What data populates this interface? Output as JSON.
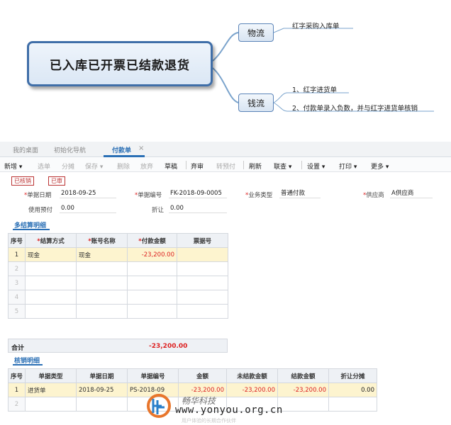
{
  "mindmap": {
    "root": "已入库已开票已结款退货",
    "branches": [
      {
        "label": "物流",
        "items": [
          "红字采购入库单"
        ]
      },
      {
        "label": "钱流",
        "items": [
          "1、红字进货单",
          "2、付款单录入负数，并与红字进货单核销"
        ]
      }
    ]
  },
  "tabs": [
    {
      "label": "我的桌面"
    },
    {
      "label": "初始化导航"
    },
    {
      "label": "付款单"
    }
  ],
  "toolbar": {
    "items": [
      {
        "label": "新增 ▾",
        "enabled": true
      },
      {
        "label": "选单",
        "enabled": false
      },
      {
        "label": "分摊",
        "enabled": false
      },
      {
        "label": "保存 ▾",
        "enabled": false
      },
      {
        "label": "删除",
        "enabled": false
      },
      {
        "label": "放弃",
        "enabled": false
      },
      {
        "label": "草稿",
        "enabled": true
      },
      {
        "label": "弃审",
        "enabled": true
      },
      {
        "label": "转预付",
        "enabled": false
      },
      {
        "label": "刷新",
        "enabled": true
      },
      {
        "label": "联查 ▾",
        "enabled": true
      },
      {
        "label": "设置 ▾",
        "enabled": true
      },
      {
        "label": "打印 ▾",
        "enabled": true
      },
      {
        "label": "更多 ▾",
        "enabled": true
      }
    ]
  },
  "status_badges": [
    "已核销",
    "已审"
  ],
  "form": {
    "doc_date_label": "单据日期",
    "doc_date": "2018-09-25",
    "doc_no_label": "单据编号",
    "doc_no": "FK-2018-09-0005",
    "biz_type_label": "业务类型",
    "biz_type": "普通付款",
    "supplier_label": "供应商",
    "supplier": "A供应商",
    "prepay_label": "使用预付",
    "prepay": "0.00",
    "discount_label": "折让",
    "discount": "0.00"
  },
  "settlement": {
    "title": "多结算明细",
    "columns": [
      "序号",
      "结算方式",
      "账号名称",
      "付款金额",
      "票据号"
    ],
    "rows": [
      {
        "seq": "1",
        "method": "现金",
        "account": "现金",
        "amount": "-23,200.00",
        "ticket": ""
      },
      {
        "seq": "2",
        "method": "",
        "account": "",
        "amount": "",
        "ticket": ""
      },
      {
        "seq": "3",
        "method": "",
        "account": "",
        "amount": "",
        "ticket": ""
      },
      {
        "seq": "4",
        "method": "",
        "account": "",
        "amount": "",
        "ticket": ""
      },
      {
        "seq": "5",
        "method": "",
        "account": "",
        "amount": "",
        "ticket": ""
      }
    ],
    "total_label": "合计",
    "total_value": "-23,200.00"
  },
  "writeoff": {
    "title": "核销明细",
    "columns": [
      "序号",
      "单据类型",
      "单据日期",
      "单据编号",
      "金额",
      "未结款金额",
      "结款金额",
      "折让分摊"
    ],
    "rows": [
      {
        "seq": "1",
        "type": "进货单",
        "date": "2018-09-25",
        "no": "PS-2018-09",
        "amount": "-23,200.00",
        "unpaid": "-23,200.00",
        "paid": "-23,200.00",
        "discount": "0.00"
      },
      {
        "seq": "2",
        "type": "",
        "date": "",
        "no": "",
        "amount": "",
        "unpaid": "",
        "paid": "",
        "discount": ""
      }
    ]
  },
  "watermark": {
    "brand": "畅华科技",
    "url": "www.yonyou.org.cn",
    "footer_faint": "用户体验的长期合作伙伴"
  }
}
